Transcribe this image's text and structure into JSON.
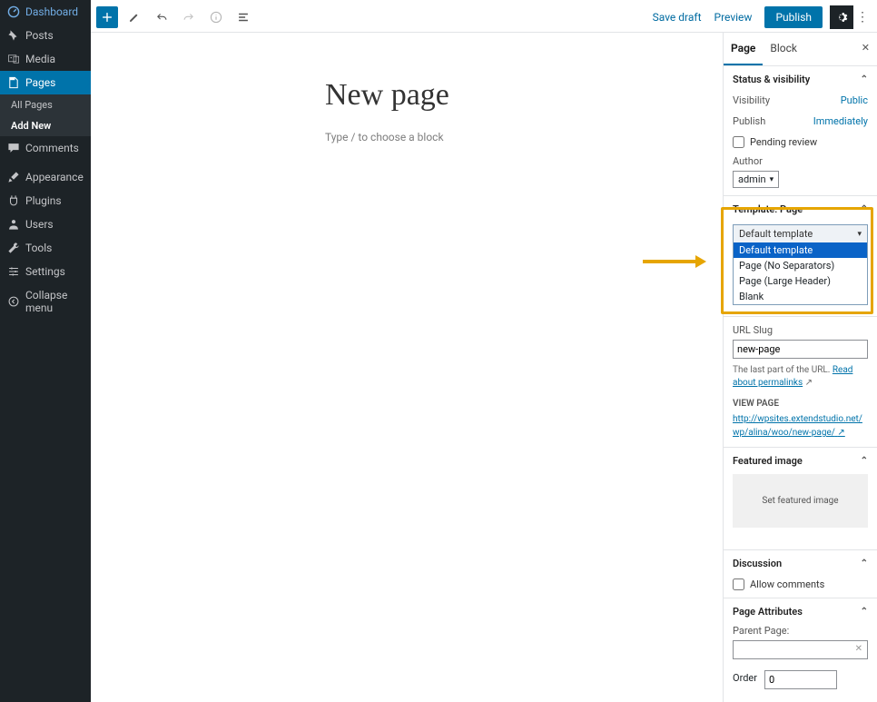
{
  "admin_menu": [
    {
      "label": "Dashboard",
      "icon": "dashboard"
    },
    {
      "label": "Posts",
      "icon": "pin"
    },
    {
      "label": "Media",
      "icon": "media"
    },
    {
      "label": "Pages",
      "icon": "page"
    },
    {
      "label": "Comments",
      "icon": "comment"
    },
    {
      "label": "Appearance",
      "icon": "brush"
    },
    {
      "label": "Plugins",
      "icon": "plug"
    },
    {
      "label": "Users",
      "icon": "user"
    },
    {
      "label": "Tools",
      "icon": "wrench"
    },
    {
      "label": "Settings",
      "icon": "sliders"
    },
    {
      "label": "Collapse menu",
      "icon": "collapse"
    }
  ],
  "admin_submenu": {
    "allpages": "All Pages",
    "addnew": "Add New"
  },
  "toolbar": {
    "save": "Save draft",
    "preview": "Preview",
    "publish": "Publish"
  },
  "canvas": {
    "title": "New page",
    "placeholder": "Type / to choose a block"
  },
  "tabs": {
    "page": "Page",
    "block": "Block"
  },
  "status": {
    "heading": "Status & visibility",
    "visibility_k": "Visibility",
    "visibility_v": "Public",
    "publish_k": "Publish",
    "publish_v": "Immediately",
    "pending": "Pending review",
    "author_lbl": "Author",
    "author_val": "admin"
  },
  "template": {
    "heading": "Template: Page",
    "selected": "Default template",
    "options": [
      "Default template",
      "Page (No Separators)",
      "Page (Large Header)",
      "Blank"
    ]
  },
  "permalink": {
    "slug_lbl": "URL Slug",
    "slug_val": "new-page",
    "hint": "The last part of the URL. ",
    "read": "Read about permalinks",
    "view_lbl": "VIEW PAGE",
    "url_a": "http://wpsites.extendstudio.net/wp/alina/w",
    "url_b": "oo/new-page/"
  },
  "featured": {
    "heading": "Featured image",
    "set": "Set featured image"
  },
  "discussion": {
    "heading": "Discussion",
    "allow": "Allow comments"
  },
  "attrs": {
    "heading": "Page Attributes",
    "parent": "Parent Page:",
    "order_lbl": "Order",
    "order_val": "0"
  }
}
